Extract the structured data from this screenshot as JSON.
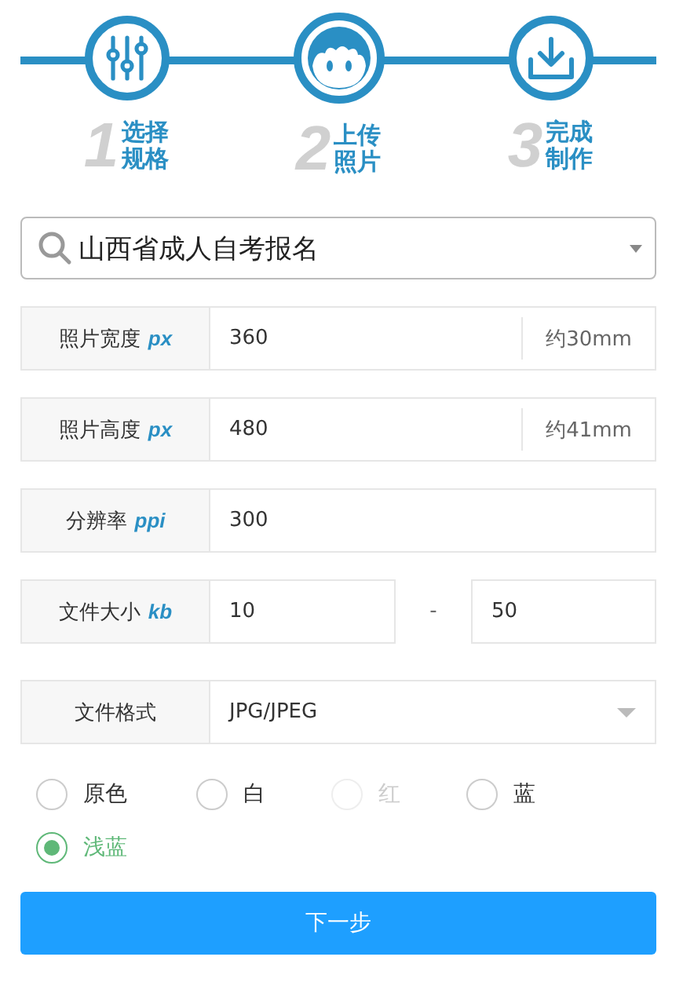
{
  "steps": [
    {
      "number": "1",
      "lines": [
        "选择",
        "规格"
      ]
    },
    {
      "number": "2",
      "lines": [
        "上传",
        "照片"
      ]
    },
    {
      "number": "3",
      "lines": [
        "完成",
        "制作"
      ]
    }
  ],
  "spec_select": {
    "value": "山西省成人自考报名"
  },
  "fields": [
    {
      "kind": "input",
      "label": "照片宽度",
      "unit": "px",
      "value": "360",
      "suffix": "约30mm"
    },
    {
      "kind": "input",
      "label": "照片高度",
      "unit": "px",
      "value": "480",
      "suffix": "约41mm"
    },
    {
      "kind": "input",
      "label": "分辨率",
      "unit": "ppi",
      "value": "300"
    },
    {
      "kind": "range",
      "label": "文件大小",
      "unit": "kb",
      "min": "10",
      "separator": "-",
      "max": "50"
    },
    {
      "kind": "select",
      "label": "文件格式",
      "value": "JPG/JPEG"
    }
  ],
  "background_colors": [
    {
      "label": "原色",
      "selected": false,
      "disabled": false
    },
    {
      "label": "白",
      "selected": false,
      "disabled": false
    },
    {
      "label": "红",
      "selected": false,
      "disabled": true
    },
    {
      "label": "蓝",
      "selected": false,
      "disabled": false
    },
    {
      "label": "浅蓝",
      "selected": true,
      "disabled": false
    }
  ],
  "next_button": "下一步"
}
